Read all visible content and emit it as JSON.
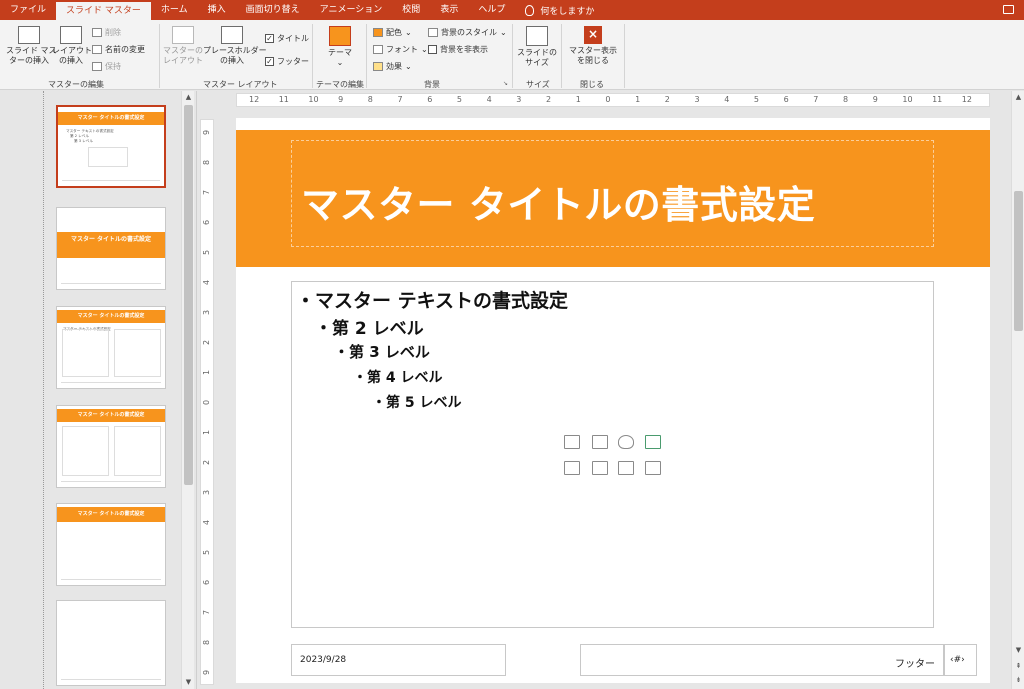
{
  "tabs": [
    "ファイル",
    "スライド マスター",
    "ホーム",
    "挿入",
    "画面切り替え",
    "アニメーション",
    "校閲",
    "表示",
    "ヘルプ"
  ],
  "tell_me": "何をしますか",
  "ribbon": {
    "insert_master": [
      "スライド マス",
      "ターの挿入"
    ],
    "insert_layout": [
      "レイアウト",
      "の挿入"
    ],
    "delete": "削除",
    "rename": "名前の変更",
    "preserve": "保持",
    "group_edit_master": "マスターの編集",
    "master_layout": [
      "マスターの",
      "レイアウト"
    ],
    "insert_placeholder": [
      "プレースホルダー",
      "の挿入"
    ],
    "title_check": "タイトル",
    "footer_check": "フッター",
    "group_master_layout": "マスター レイアウト",
    "theme": "テーマ",
    "group_edit_theme": "テーマの編集",
    "colors": "配色",
    "fonts": "フォント",
    "effects": "効果",
    "bg_styles": "背景のスタイル",
    "hide_bg": "背景を非表示",
    "group_background": "背景",
    "slide_size": [
      "スライドの",
      "サイズ"
    ],
    "group_size": "サイズ",
    "close_master": [
      "マスター表示",
      "を閉じる"
    ],
    "group_close": "閉じる"
  },
  "thumbs": {
    "master_title": "マスター タイトルの書式設定",
    "master_text": "マスター テキストの書式設定",
    "sub_text": "マスター テキストの書式設定",
    "l2": "第 2 レベル",
    "l3": "第 3 レベル"
  },
  "slide": {
    "title": "マスター タイトルの書式設定",
    "levels": [
      "・マスター テキストの書式設定",
      "・第 2 レベル",
      "・第 3 レベル",
      "・第 4 レベル",
      "・第 5 レベル"
    ],
    "date": "2023/9/28",
    "footer": "フッター",
    "slide_number": "‹#›"
  },
  "ruler": {
    "h": [
      "12",
      "11",
      "10",
      "9",
      "8",
      "7",
      "6",
      "5",
      "4",
      "3",
      "2",
      "1",
      "0",
      "1",
      "2",
      "3",
      "4",
      "5",
      "6",
      "7",
      "8",
      "9",
      "10",
      "11",
      "12"
    ],
    "v": [
      "9",
      "8",
      "7",
      "6",
      "5",
      "4",
      "3",
      "2",
      "1",
      "0",
      "1",
      "2",
      "3",
      "4",
      "5",
      "6",
      "7",
      "8",
      "9"
    ]
  }
}
